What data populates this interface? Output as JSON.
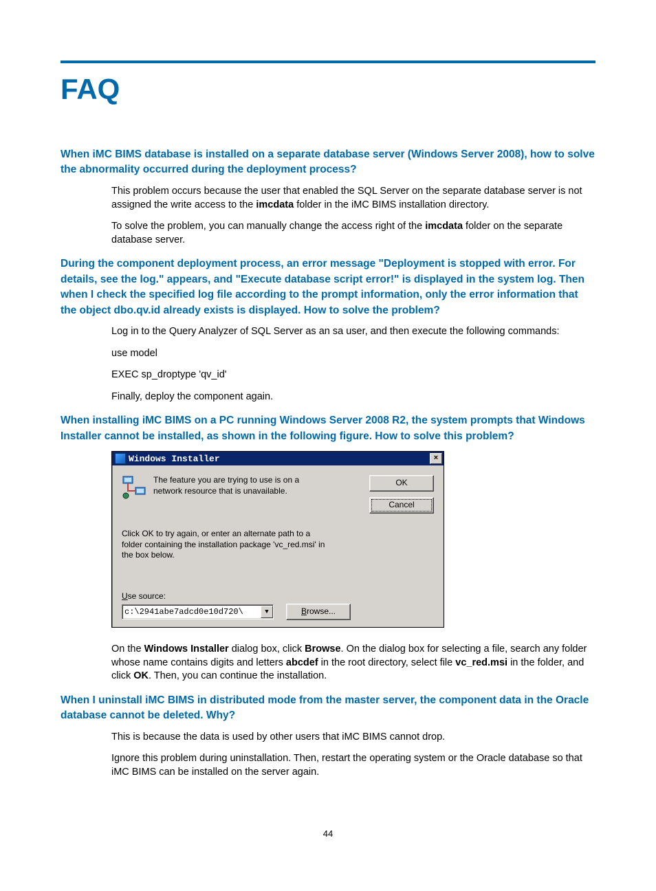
{
  "page": {
    "title": "FAQ",
    "number": "44"
  },
  "q1": {
    "question": "When iMC BIMS database is installed on a separate database server (Windows Server 2008), how to solve the abnormality occurred during the deployment process?",
    "a1_pre": "This problem occurs because the user that enabled the SQL Server on the separate database server is not assigned the write access to the ",
    "a1_b1": "imcdata",
    "a1_post": " folder in the iMC BIMS installation directory.",
    "a2_pre": "To solve the problem, you can manually change the access right of the ",
    "a2_b1": "imcdata",
    "a2_post": " folder on the separate database server."
  },
  "q2": {
    "question": "During the component deployment process, an error message \"Deployment is stopped with error. For details, see the log.\" appears, and \"Execute database script error!\" is displayed in the system log. Then when I check the specified log file according to the prompt information, only the error information that the object dbo.qv.id already exists is displayed. How to solve the problem?",
    "a1": "Log in to the Query Analyzer of SQL Server as an sa user, and then execute the following commands:",
    "a2": "use model",
    "a3": "EXEC sp_droptype 'qv_id'",
    "a4": "Finally, deploy the component again."
  },
  "q3": {
    "question": "When installing iMC BIMS on a PC running Windows Server 2008 R2, the system prompts that Windows Installer cannot be installed, as shown in the following figure. How to solve this problem?",
    "ans_pre": "On the ",
    "ans_b1": "Windows Installer",
    "ans_mid1": " dialog box, click ",
    "ans_b2": "Browse",
    "ans_mid2": ". On the dialog box for selecting a file, search any folder whose name contains digits and letters ",
    "ans_b3": "abcdef",
    "ans_mid3": " in the root directory, select file ",
    "ans_b4": "vc_red.msi",
    "ans_mid4": " in the folder, and click ",
    "ans_b5": "OK",
    "ans_post": ". Then, you can continue the installation."
  },
  "q4": {
    "question": "When I uninstall iMC BIMS in distributed mode from the master server, the component data in the Oracle database cannot be deleted. Why?",
    "a1": "This is because the data is used by other users that iMC BIMS cannot drop.",
    "a2": "Ignore this problem during uninstallation. Then, restart the operating system or the Oracle database so that iMC BIMS can be installed on the server again."
  },
  "dialog": {
    "title": "Windows Installer",
    "msg1": "The feature you are trying to use is on a network resource that is unavailable.",
    "ok": "OK",
    "cancel": "Cancel",
    "msg2": "Click OK to try again, or enter an alternate path to a folder containing the installation package 'vc_red.msi' in the box below.",
    "use_u": "U",
    "use_rest": "se source:",
    "path": "c:\\2941abe7adcd0e10d720\\",
    "browse_u": "B",
    "browse_rest": "rowse..."
  }
}
